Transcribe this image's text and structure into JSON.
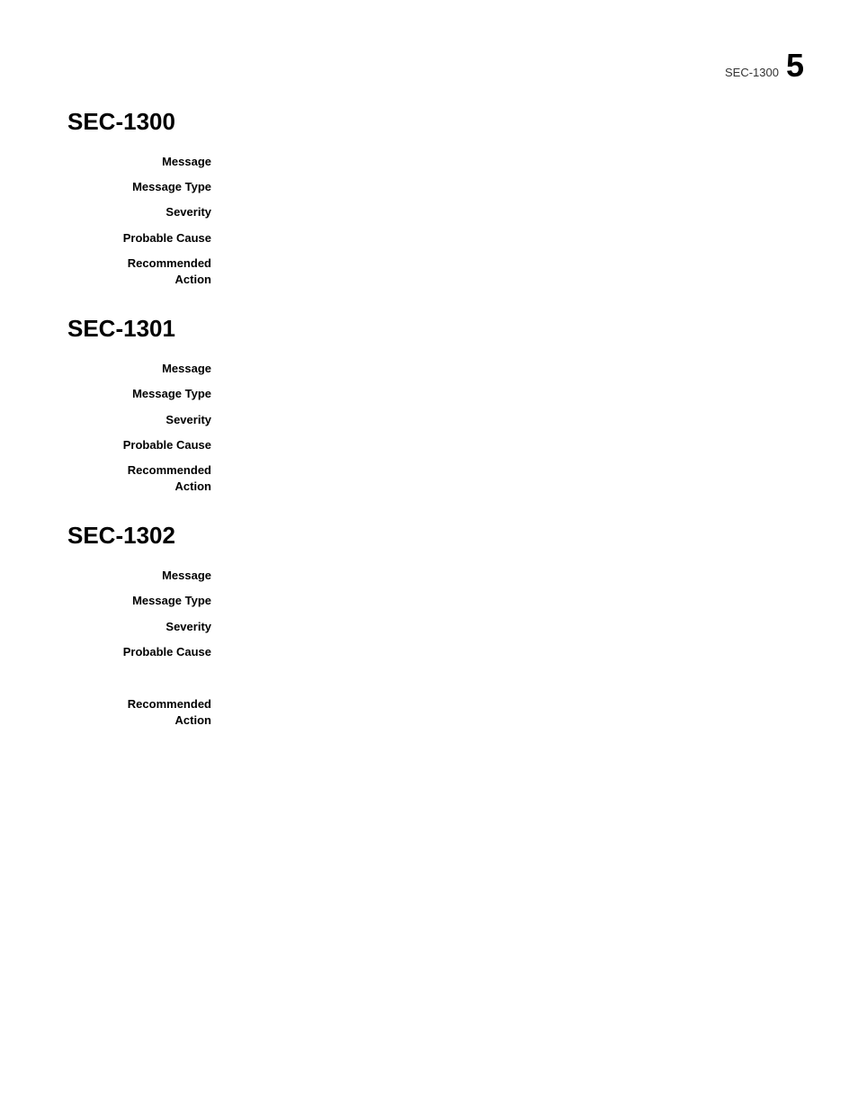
{
  "header": {
    "section_id": "SEC-1300",
    "page_number": "5"
  },
  "sections": [
    {
      "id": "sec-1300",
      "title": "SEC-1300",
      "fields": [
        {
          "label": "Message",
          "value": ""
        },
        {
          "label": "Message Type",
          "value": ""
        },
        {
          "label": "Severity",
          "value": ""
        },
        {
          "label": "Probable Cause",
          "value": ""
        },
        {
          "label": "Recommended Action",
          "value": ""
        }
      ]
    },
    {
      "id": "sec-1301",
      "title": "SEC-1301",
      "fields": [
        {
          "label": "Message",
          "value": ""
        },
        {
          "label": "Message Type",
          "value": ""
        },
        {
          "label": "Severity",
          "value": ""
        },
        {
          "label": "Probable Cause",
          "value": ""
        },
        {
          "label": "Recommended Action",
          "value": ""
        }
      ]
    },
    {
      "id": "sec-1302",
      "title": "SEC-1302",
      "fields": [
        {
          "label": "Message",
          "value": ""
        },
        {
          "label": "Message Type",
          "value": ""
        },
        {
          "label": "Severity",
          "value": ""
        },
        {
          "label": "Probable Cause",
          "value": ""
        },
        {
          "label": "Recommended Action",
          "value": ""
        }
      ]
    }
  ]
}
